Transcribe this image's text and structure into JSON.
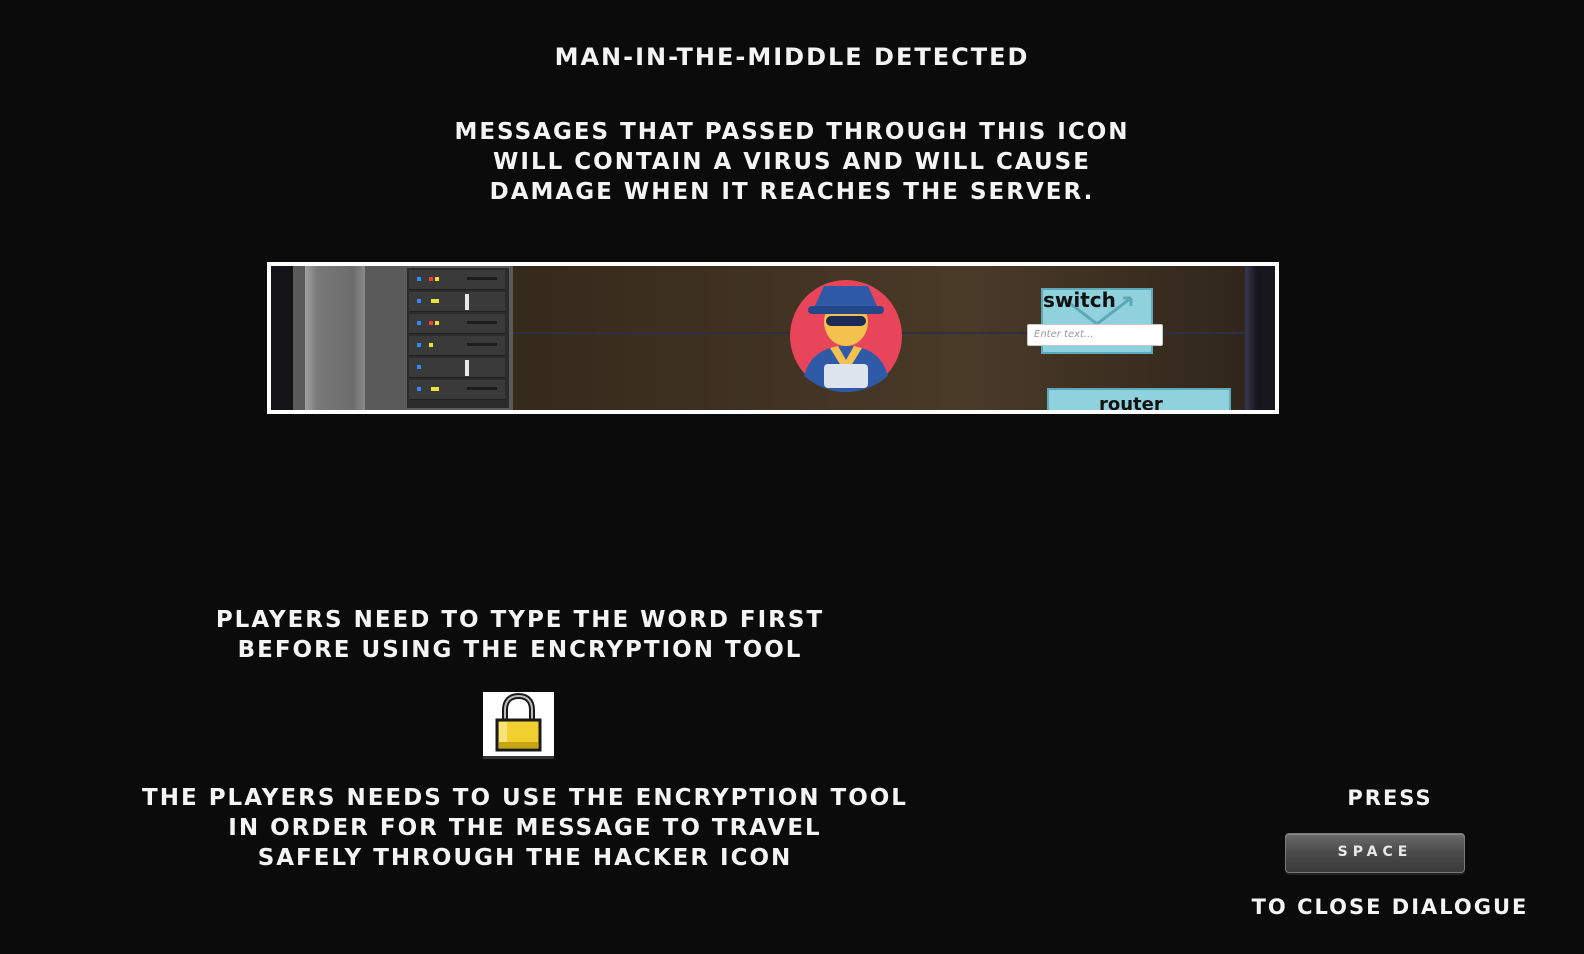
{
  "dialog": {
    "title": "Man-in-the-middle detected",
    "description_lines": [
      "Messages that passed through this icon",
      "will contain a virus and will cause",
      "damage when it reaches the server."
    ],
    "screenshot": {
      "switch_label": "switch",
      "input_placeholder": "Enter text...",
      "router_label": "router"
    },
    "hint_lines": [
      "Players need to type the word first",
      "before using the encryption tool"
    ],
    "note_lines": [
      "The players needs to use the encryption tool",
      "in order for the message to travel",
      "safely through the hacker icon"
    ],
    "press_label": "Press",
    "space_key_label": "SPACE",
    "close_label": "to close dialogue"
  },
  "icons": [
    "server-rack-icon",
    "hacker-icon",
    "switch-icon",
    "router-icon",
    "lock-icon"
  ],
  "colors": {
    "background": "#0b0b0b",
    "text": "#f4f4f4",
    "hacker_circle": "#e8455a",
    "hacker_coat": "#2f5aa8",
    "lock_body": "#f0cf2e",
    "network_node": "#8fd2de"
  }
}
